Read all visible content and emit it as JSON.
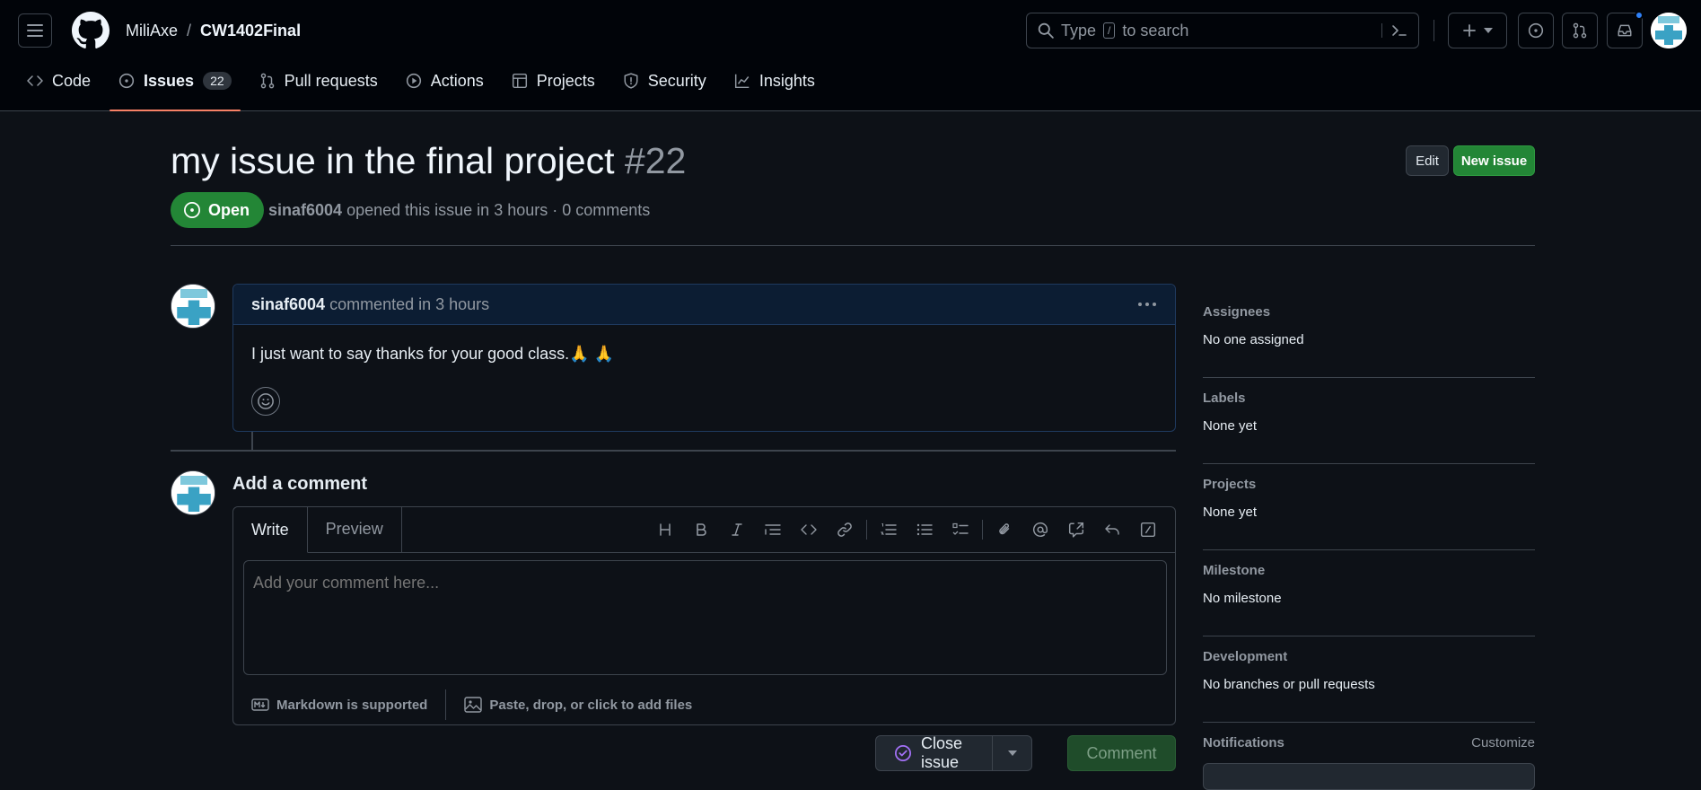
{
  "header": {
    "owner": "MiliAxe",
    "separator": "/",
    "repo": "CW1402Final",
    "search_prefix": "Type",
    "search_key": "/",
    "search_suffix": "to search"
  },
  "nav": {
    "tabs": [
      {
        "label": "Code",
        "icon": "code-icon"
      },
      {
        "label": "Issues",
        "icon": "issue-opened-icon",
        "count": "22",
        "active": true
      },
      {
        "label": "Pull requests",
        "icon": "git-pull-request-icon"
      },
      {
        "label": "Actions",
        "icon": "play-icon"
      },
      {
        "label": "Projects",
        "icon": "table-icon"
      },
      {
        "label": "Security",
        "icon": "shield-icon"
      },
      {
        "label": "Insights",
        "icon": "graph-icon"
      }
    ]
  },
  "issue": {
    "title": "my issue in the final project",
    "number": "#22",
    "state": "Open",
    "author": "sinaf6004",
    "meta": "opened this issue in 3 hours · 0 comments",
    "edit_label": "Edit",
    "new_issue_label": "New issue"
  },
  "comment": {
    "author": "sinaf6004",
    "time": "commented in 3 hours",
    "body": "I just want to say thanks for your good class.🙏 🙏"
  },
  "composer": {
    "title": "Add a comment",
    "tab_write": "Write",
    "tab_preview": "Preview",
    "placeholder": "Add your comment here...",
    "markdown_note": "Markdown is supported",
    "attach_note": "Paste, drop, or click to add files",
    "close_issue_label": "Close issue",
    "comment_label": "Comment"
  },
  "sidebar": {
    "sections": [
      {
        "title": "Assignees",
        "value": "No one assigned"
      },
      {
        "title": "Labels",
        "value": "None yet"
      },
      {
        "title": "Projects",
        "value": "None yet"
      },
      {
        "title": "Milestone",
        "value": "No milestone"
      },
      {
        "title": "Development",
        "value": "No branches or pull requests"
      }
    ],
    "notifications_title": "Notifications",
    "customize_label": "Customize"
  },
  "colors": {
    "background": "#0d1117",
    "open_green": "#238636",
    "accent_underline": "#f78166",
    "comment_header": "#0c1d33"
  }
}
